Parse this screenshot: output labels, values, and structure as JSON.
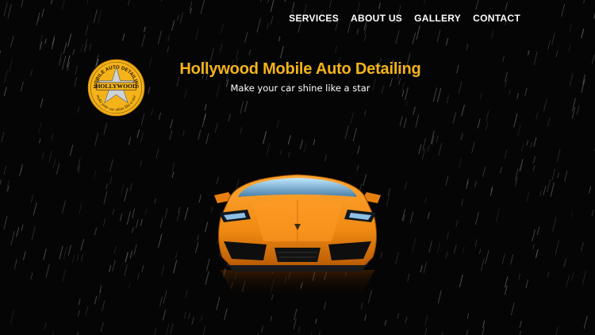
{
  "nav": {
    "items": [
      {
        "label": "SERVICES"
      },
      {
        "label": "ABOUT US"
      },
      {
        "label": "GALLERY"
      },
      {
        "label": "CONTACT"
      }
    ]
  },
  "logo": {
    "top_text": "MOBILE AUTO DETAILING",
    "center_text": "HOLLYWOOD",
    "bottom_text": "make your car shine like a star"
  },
  "hero": {
    "title": "Hollywood Mobile Auto Detailing",
    "subtitle": "Make your car shine like a star"
  },
  "colors": {
    "accent": "#f5b31a",
    "background": "#000000",
    "car": "#f08a12",
    "text": "#ffffff"
  },
  "icons": {
    "logo": "hollywood-star-badge-icon",
    "hero_image": "orange-sports-car"
  }
}
